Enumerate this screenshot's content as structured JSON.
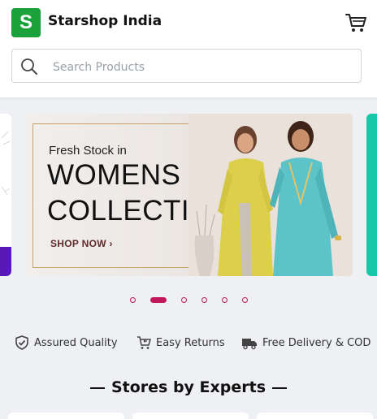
{
  "header": {
    "logo_letter": "S",
    "app_title": "Starshop India"
  },
  "search": {
    "placeholder": "Search Products"
  },
  "banner": {
    "kicker": "Fresh Stock in",
    "headline_1": "WOMENS",
    "headline_2": "COLLECTION",
    "cta": "SHOP NOW ›"
  },
  "carousel": {
    "slide_count": 6,
    "active_index": 1
  },
  "features": [
    {
      "icon": "shield-check-icon",
      "label": "Assured Quality"
    },
    {
      "icon": "cart-return-icon",
      "label": "Easy Returns"
    },
    {
      "icon": "truck-icon",
      "label": "Free Delivery & COD"
    }
  ],
  "stores": {
    "title": "Stores by Experts"
  },
  "colors": {
    "brand_green": "#1aa13a",
    "accent_pink": "#c2185b",
    "banner_gold": "#c8a165"
  }
}
